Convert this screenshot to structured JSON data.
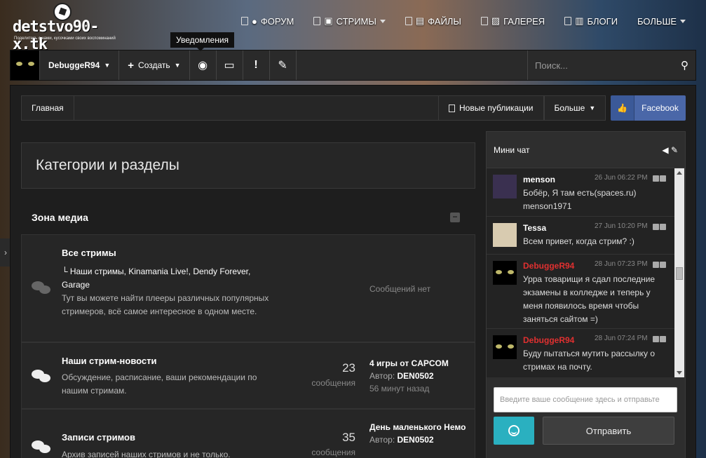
{
  "logo": {
    "title": "detstvo90-x.tk",
    "tagline": "Поделитесь с нами, кусочками своих воспоминаний"
  },
  "topnav": [
    {
      "label": "ФОРУМ",
      "icon": "chat-icon",
      "caret": false
    },
    {
      "label": "СТРИМЫ",
      "icon": "twitch-icon",
      "caret": true
    },
    {
      "label": "ФАЙЛЫ",
      "icon": "files-icon",
      "caret": false
    },
    {
      "label": "ГАЛЕРЕЯ",
      "icon": "image-icon",
      "caret": false
    },
    {
      "label": "БЛОГИ",
      "icon": "blog-icon",
      "caret": false
    },
    {
      "label": "БОЛЬШЕ",
      "icon": "",
      "caret": true
    }
  ],
  "tooltip": "Уведомления",
  "userbar": {
    "username": "DebuggeR94",
    "create": "Создать",
    "search_placeholder": "Поиск..."
  },
  "breadcrumb": {
    "home": "Главная",
    "new_pubs": "Новые публикации",
    "more": "Больше",
    "facebook": "Facebook"
  },
  "section_title": "Категории и разделы",
  "zone_title": "Зона медиа",
  "forums": [
    {
      "title": "Все стримы",
      "subs": "Наши стримы,  Kinamania Live!,  Dendy Forever,  Garage",
      "desc": "Тут вы можете найти плееры различных популярных стримеров, всё самое интересное в одном месте.",
      "nomsg": "Сообщений нет"
    },
    {
      "title": "Наши стрим-новости",
      "desc": "Обсуждение, расписание, ваши рекомендации по нашим стримам.",
      "count": "23",
      "count_label": "сообщения",
      "last_title": "4 игры от CAPCOM",
      "last_author_label": "Автор:",
      "last_author": "DEN0502",
      "last_when": "56 минут назад"
    },
    {
      "title": "Записи стримов",
      "desc": "Архив записей наших стримов и не только.",
      "count": "35",
      "count_label": "сообщения",
      "last_title": "День маленького Немо",
      "last_author_label": "Автор:",
      "last_author": "DEN0502"
    }
  ],
  "chat": {
    "title": "Мини чат",
    "messages": [
      {
        "name": "menson",
        "time": "26 Jun 06:22 PM",
        "text": "Бобёр, Я там есть(spaces.ru) menson1971",
        "color": "#ffffff"
      },
      {
        "name": "Tessa",
        "time": "27 Jun 10:20 PM",
        "text": "Всем привет, когда стрим? :)",
        "color": "#ffffff"
      },
      {
        "name": "DebuggeR94",
        "time": "28 Jun 07:23 PM",
        "text": "Урра товарищи я сдал последние экзамены в колледже и теперь у меня появилось время чтобы заняться сайтом =)",
        "color": "#e03030"
      },
      {
        "name": "DebuggeR94",
        "time": "28 Jun 07:24 PM",
        "text": "Буду пытаться мутить рассылку о стримах на почту.",
        "color": "#e03030"
      }
    ],
    "input_placeholder": "Введите ваше сообщение здесь и отправьте",
    "send": "Отправить"
  }
}
